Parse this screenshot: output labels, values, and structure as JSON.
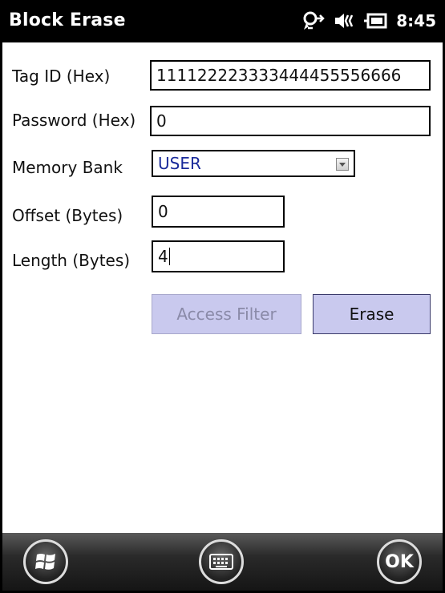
{
  "title_bar": {
    "title": "Block Erase",
    "time": "8:45"
  },
  "form": {
    "tag_id": {
      "label": "Tag ID (Hex)",
      "value": "111122223333444455556666"
    },
    "password": {
      "label": "Password (Hex)",
      "value": "0"
    },
    "memory_bank": {
      "label": "Memory Bank",
      "value": "USER"
    },
    "offset": {
      "label": "Offset (Bytes)",
      "value": "0"
    },
    "length": {
      "label": "Length (Bytes)",
      "value": "4"
    }
  },
  "buttons": {
    "access_filter": "Access Filter",
    "erase": "Erase"
  },
  "bottom_bar": {
    "ok_label": "OK"
  },
  "icons": [
    "connectivity-icon",
    "volume-icon",
    "battery-icon",
    "windows-start-icon",
    "keyboard-icon",
    "ok-icon",
    "dropdown-arrow-icon"
  ]
}
